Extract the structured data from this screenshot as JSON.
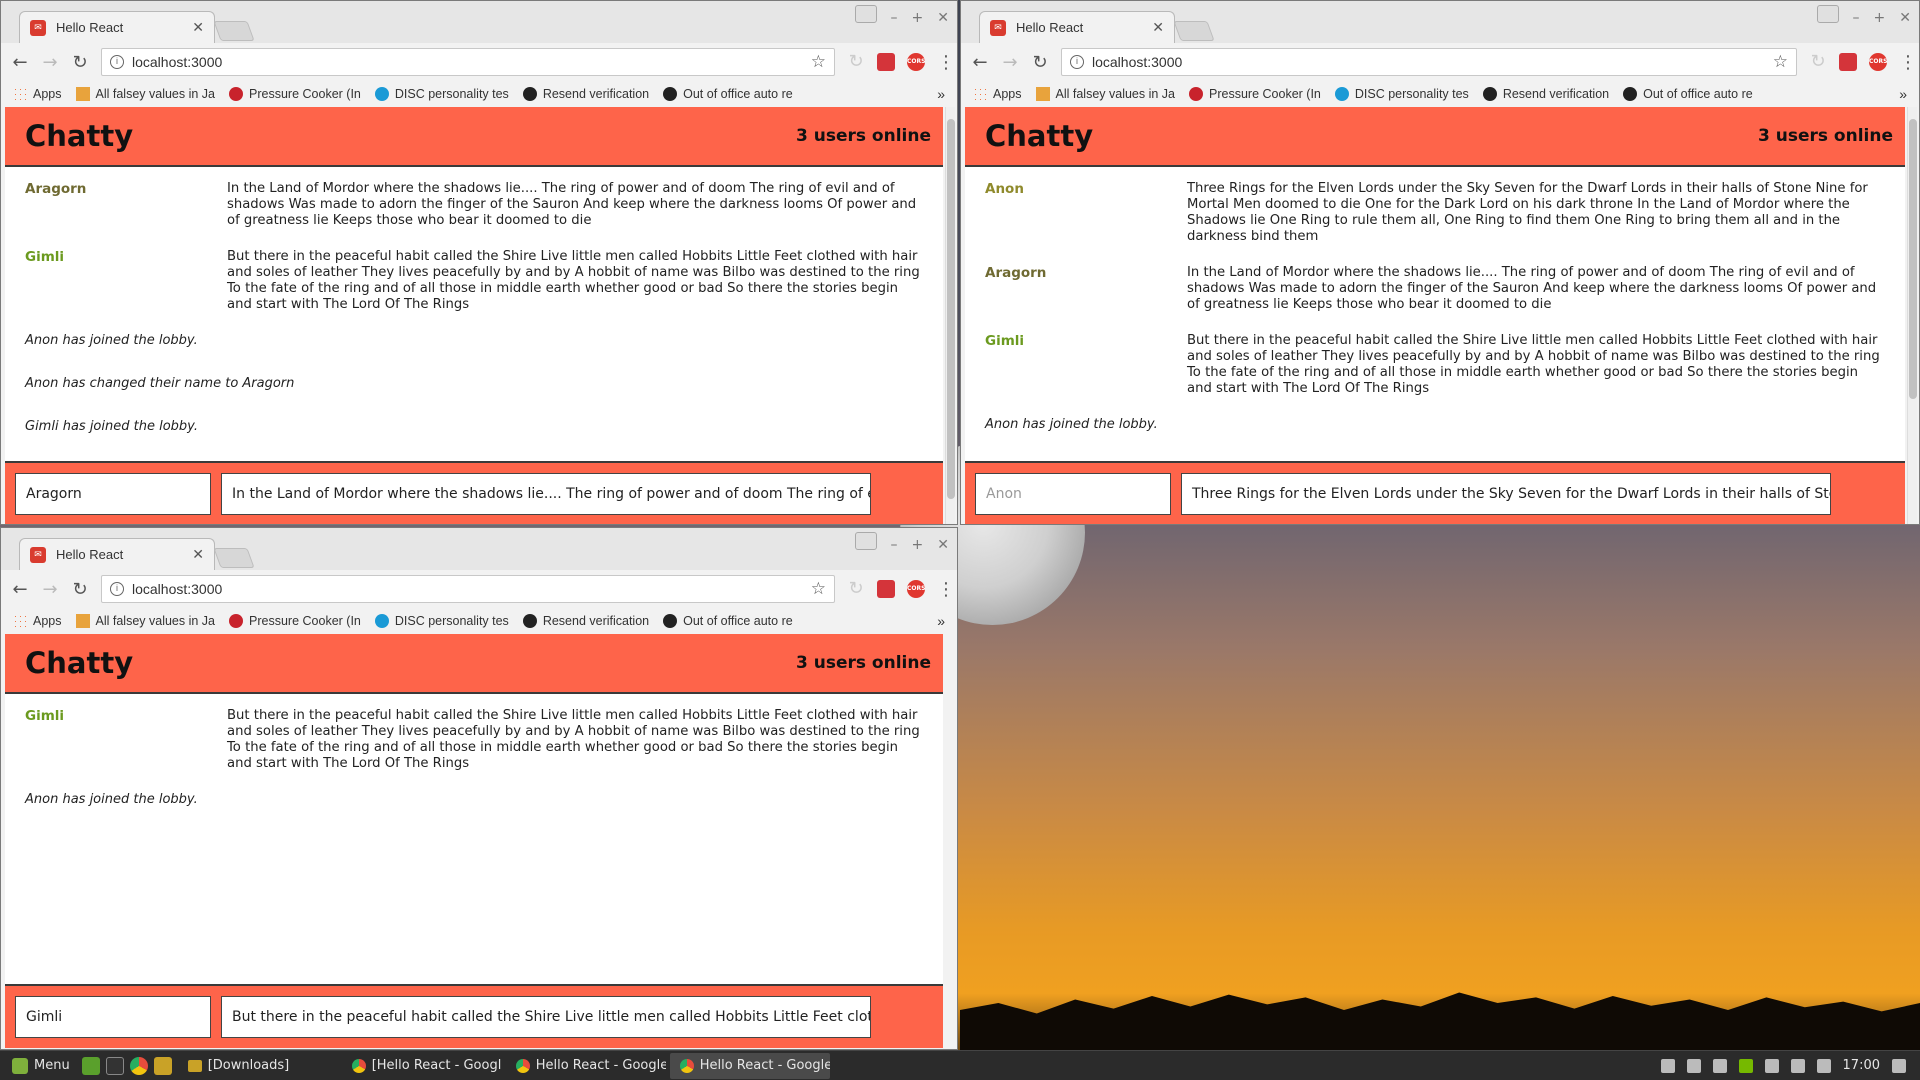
{
  "browser": {
    "tab_title": "Hello React",
    "url": "localhost:3000",
    "bookmarks": [
      {
        "label": "Apps",
        "icon": "apps-grid-icon"
      },
      {
        "label": "All falsey values in Ja",
        "icon": "bookmark-favicon"
      },
      {
        "label": "Pressure Cooker (In",
        "icon": "pinterest-icon"
      },
      {
        "label": "DISC personality tes",
        "icon": "globe-icon"
      },
      {
        "label": "Resend verification",
        "icon": "github-icon"
      },
      {
        "label": "Out of office auto re",
        "icon": "github-icon"
      }
    ],
    "bookmark_overflow": "»",
    "cors_label": "CORS"
  },
  "app": {
    "title": "Chatty",
    "users_online": "3 users online"
  },
  "windows": [
    {
      "id": "top-left",
      "messages": [
        {
          "user": "Aragorn",
          "color": "#6f6a32",
          "text": "In the Land of Mordor where the shadows lie.... The ring of power and of doom The ring of evil and of shadows Was made to adorn the finger of the Sauron And keep where the darkness looms Of power and of greatness lie Keeps those who bear it doomed to die"
        },
        {
          "user": "Gimli",
          "color": "#6b9a1f",
          "text": "But there in the peaceful habit called the Shire Live little men called Hobbits Little Feet clothed with hair and soles of leather They lives peacefully by and by A hobbit of name was Bilbo was destined to the ring To the fate of the ring and of all those in middle earth whether good or bad So there the stories begin and start with The Lord Of The Rings"
        }
      ],
      "notifications": [
        "Anon has joined the lobby.",
        "Anon has changed their name to Aragorn",
        "Gimli has joined the lobby."
      ],
      "name_value": "Aragorn",
      "message_value": "In the Land of Mordor where the shadows lie.... The ring of power and of doom The ring of evil a"
    },
    {
      "id": "top-right",
      "messages": [
        {
          "user": "Anon",
          "color": "#8f8a2c",
          "text": "Three Rings for the Elven Lords under the Sky Seven for the Dwarf Lords in their halls of Stone Nine for Mortal Men doomed to die One for the Dark Lord on his dark throne In the Land of Mordor where the Shadows lie One Ring to rule them all, One Ring to find them One Ring to bring them all and in the darkness bind them"
        },
        {
          "user": "Aragorn",
          "color": "#6f6a32",
          "text": "In the Land of Mordor where the shadows lie.... The ring of power and of doom The ring of evil and of shadows Was made to adorn the finger of the Sauron And keep where the darkness looms Of power and of greatness lie Keeps those who bear it doomed to die"
        },
        {
          "user": "Gimli",
          "color": "#6b9a1f",
          "text": "But there in the peaceful habit called the Shire Live little men called Hobbits Little Feet clothed with hair and soles of leather They lives peacefully by and by A hobbit of name was Bilbo was destined to the ring To the fate of the ring and of all those in middle earth whether good or bad So there the stories begin and start with The Lord Of The Rings"
        }
      ],
      "notifications": [
        "Anon has joined the lobby."
      ],
      "name_value": "",
      "name_placeholder": "Anon",
      "message_value": "Three Rings for the Elven Lords under the Sky Seven for the Dwarf Lords in their halls of Stone N"
    },
    {
      "id": "bottom-left",
      "messages": [
        {
          "user": "Gimli",
          "color": "#6b9a1f",
          "text": "But there in the peaceful habit called the Shire Live little men called Hobbits Little Feet clothed with hair and soles of leather They lives peacefully by and by A hobbit of name was Bilbo was destined to the ring To the fate of the ring and of all those in middle earth whether good or bad So there the stories begin and start with The Lord Of The Rings"
        }
      ],
      "notifications": [
        "Anon has joined the lobby."
      ],
      "name_value": "Gimli",
      "message_value": "But there in the peaceful habit called the Shire Live little men called Hobbits Little Feet clothed witl"
    }
  ],
  "taskbar": {
    "menu_label": "Menu",
    "tasks": [
      {
        "label": "[Downloads]",
        "icon": "folder-icon",
        "active": false
      },
      {
        "label": "[Hello React - Googl...",
        "icon": "chrome-icon",
        "active": false
      },
      {
        "label": "Hello React - Google...",
        "icon": "chrome-icon",
        "active": false
      },
      {
        "label": "Hello React - Google...",
        "icon": "chrome-icon",
        "active": true
      }
    ],
    "clock": "17:00"
  }
}
